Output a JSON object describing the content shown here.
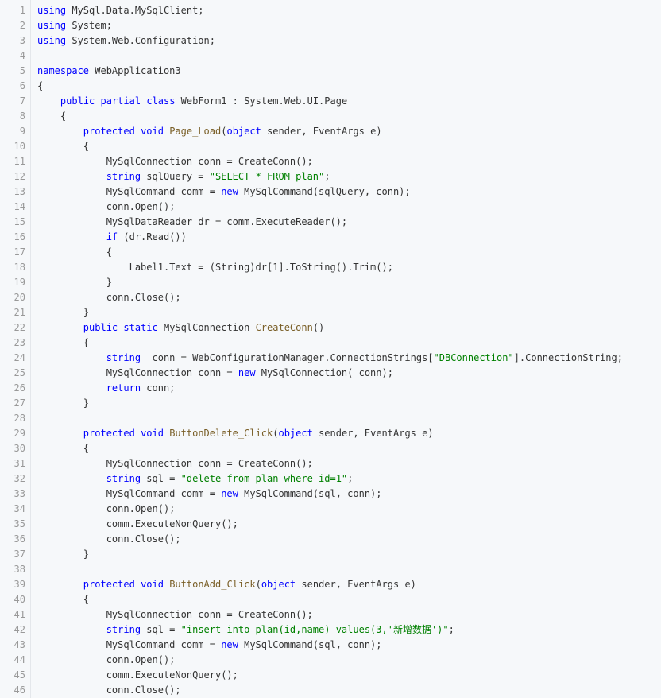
{
  "colors": {
    "background": "#f6f8fa",
    "line_number": "#999999",
    "text": "#333333",
    "keyword": "#0000ff",
    "string": "#008000",
    "method": "#795e26",
    "type": "#2b6ea8"
  },
  "code": {
    "lines": [
      {
        "n": "1",
        "tokens": [
          [
            "kw",
            "using"
          ],
          [
            "plain",
            " MySql.Data.MySqlClient;"
          ]
        ]
      },
      {
        "n": "2",
        "tokens": [
          [
            "kw",
            "using"
          ],
          [
            "plain",
            " System;"
          ]
        ]
      },
      {
        "n": "3",
        "tokens": [
          [
            "kw",
            "using"
          ],
          [
            "plain",
            " System.Web.Configuration;"
          ]
        ]
      },
      {
        "n": "4",
        "tokens": []
      },
      {
        "n": "5",
        "tokens": [
          [
            "kw",
            "namespace"
          ],
          [
            "plain",
            " WebApplication3"
          ]
        ]
      },
      {
        "n": "6",
        "tokens": [
          [
            "plain",
            "{"
          ]
        ]
      },
      {
        "n": "7",
        "tokens": [
          [
            "plain",
            "    "
          ],
          [
            "kw",
            "public"
          ],
          [
            "plain",
            " "
          ],
          [
            "kw",
            "partial"
          ],
          [
            "plain",
            " "
          ],
          [
            "kw",
            "class"
          ],
          [
            "plain",
            " WebForm1 : System.Web.UI.Page"
          ]
        ]
      },
      {
        "n": "8",
        "tokens": [
          [
            "plain",
            "    {"
          ]
        ]
      },
      {
        "n": "9",
        "tokens": [
          [
            "plain",
            "        "
          ],
          [
            "kw",
            "protected"
          ],
          [
            "plain",
            " "
          ],
          [
            "kw",
            "void"
          ],
          [
            "plain",
            " "
          ],
          [
            "fn",
            "Page_Load"
          ],
          [
            "plain",
            "("
          ],
          [
            "kw",
            "object"
          ],
          [
            "plain",
            " sender, EventArgs e)"
          ]
        ]
      },
      {
        "n": "10",
        "tokens": [
          [
            "plain",
            "        {"
          ]
        ]
      },
      {
        "n": "11",
        "tokens": [
          [
            "plain",
            "            MySqlConnection conn = CreateConn();"
          ]
        ]
      },
      {
        "n": "12",
        "tokens": [
          [
            "plain",
            "            "
          ],
          [
            "kw",
            "string"
          ],
          [
            "plain",
            " sqlQuery = "
          ],
          [
            "str",
            "\"SELECT * FROM plan\""
          ],
          [
            "plain",
            ";"
          ]
        ]
      },
      {
        "n": "13",
        "tokens": [
          [
            "plain",
            "            MySqlCommand comm = "
          ],
          [
            "kw",
            "new"
          ],
          [
            "plain",
            " MySqlCommand(sqlQuery, conn);"
          ]
        ]
      },
      {
        "n": "14",
        "tokens": [
          [
            "plain",
            "            conn.Open();"
          ]
        ]
      },
      {
        "n": "15",
        "tokens": [
          [
            "plain",
            "            MySqlDataReader dr = comm.ExecuteReader();"
          ]
        ]
      },
      {
        "n": "16",
        "tokens": [
          [
            "plain",
            "            "
          ],
          [
            "kw",
            "if"
          ],
          [
            "plain",
            " (dr.Read())"
          ]
        ]
      },
      {
        "n": "17",
        "tokens": [
          [
            "plain",
            "            {"
          ]
        ]
      },
      {
        "n": "18",
        "tokens": [
          [
            "plain",
            "                Label1.Text = (String)dr[1].ToString().Trim();"
          ]
        ]
      },
      {
        "n": "19",
        "tokens": [
          [
            "plain",
            "            }"
          ]
        ]
      },
      {
        "n": "20",
        "tokens": [
          [
            "plain",
            "            conn.Close();"
          ]
        ]
      },
      {
        "n": "21",
        "tokens": [
          [
            "plain",
            "        }"
          ]
        ]
      },
      {
        "n": "22",
        "tokens": [
          [
            "plain",
            "        "
          ],
          [
            "kw",
            "public"
          ],
          [
            "plain",
            " "
          ],
          [
            "kw",
            "static"
          ],
          [
            "plain",
            " MySqlConnection "
          ],
          [
            "fn",
            "CreateConn"
          ],
          [
            "plain",
            "()"
          ]
        ]
      },
      {
        "n": "23",
        "tokens": [
          [
            "plain",
            "        {"
          ]
        ]
      },
      {
        "n": "24",
        "tokens": [
          [
            "plain",
            "            "
          ],
          [
            "kw",
            "string"
          ],
          [
            "plain",
            " _conn = WebConfigurationManager.ConnectionStrings["
          ],
          [
            "str",
            "\"DBConnection\""
          ],
          [
            "plain",
            "].ConnectionString;"
          ]
        ]
      },
      {
        "n": "25",
        "tokens": [
          [
            "plain",
            "            MySqlConnection conn = "
          ],
          [
            "kw",
            "new"
          ],
          [
            "plain",
            " MySqlConnection(_conn);"
          ]
        ]
      },
      {
        "n": "26",
        "tokens": [
          [
            "plain",
            "            "
          ],
          [
            "kw",
            "return"
          ],
          [
            "plain",
            " conn;"
          ]
        ]
      },
      {
        "n": "27",
        "tokens": [
          [
            "plain",
            "        }"
          ]
        ]
      },
      {
        "n": "28",
        "tokens": []
      },
      {
        "n": "29",
        "tokens": [
          [
            "plain",
            "        "
          ],
          [
            "kw",
            "protected"
          ],
          [
            "plain",
            " "
          ],
          [
            "kw",
            "void"
          ],
          [
            "plain",
            " "
          ],
          [
            "fn",
            "ButtonDelete_Click"
          ],
          [
            "plain",
            "("
          ],
          [
            "kw",
            "object"
          ],
          [
            "plain",
            " sender, EventArgs e)"
          ]
        ]
      },
      {
        "n": "30",
        "tokens": [
          [
            "plain",
            "        {"
          ]
        ]
      },
      {
        "n": "31",
        "tokens": [
          [
            "plain",
            "            MySqlConnection conn = CreateConn();"
          ]
        ]
      },
      {
        "n": "32",
        "tokens": [
          [
            "plain",
            "            "
          ],
          [
            "kw",
            "string"
          ],
          [
            "plain",
            " sql = "
          ],
          [
            "str",
            "\"delete from plan where id=1\""
          ],
          [
            "plain",
            ";"
          ]
        ]
      },
      {
        "n": "33",
        "tokens": [
          [
            "plain",
            "            MySqlCommand comm = "
          ],
          [
            "kw",
            "new"
          ],
          [
            "plain",
            " MySqlCommand(sql, conn);"
          ]
        ]
      },
      {
        "n": "34",
        "tokens": [
          [
            "plain",
            "            conn.Open();"
          ]
        ]
      },
      {
        "n": "35",
        "tokens": [
          [
            "plain",
            "            comm.ExecuteNonQuery();"
          ]
        ]
      },
      {
        "n": "36",
        "tokens": [
          [
            "plain",
            "            conn.Close();"
          ]
        ]
      },
      {
        "n": "37",
        "tokens": [
          [
            "plain",
            "        }"
          ]
        ]
      },
      {
        "n": "38",
        "tokens": []
      },
      {
        "n": "39",
        "tokens": [
          [
            "plain",
            "        "
          ],
          [
            "kw",
            "protected"
          ],
          [
            "plain",
            " "
          ],
          [
            "kw",
            "void"
          ],
          [
            "plain",
            " "
          ],
          [
            "fn",
            "ButtonAdd_Click"
          ],
          [
            "plain",
            "("
          ],
          [
            "kw",
            "object"
          ],
          [
            "plain",
            " sender, EventArgs e)"
          ]
        ]
      },
      {
        "n": "40",
        "tokens": [
          [
            "plain",
            "        {"
          ]
        ]
      },
      {
        "n": "41",
        "tokens": [
          [
            "plain",
            "            MySqlConnection conn = CreateConn();"
          ]
        ]
      },
      {
        "n": "42",
        "tokens": [
          [
            "plain",
            "            "
          ],
          [
            "kw",
            "string"
          ],
          [
            "plain",
            " sql = "
          ],
          [
            "str",
            "\"insert into plan(id,name) values(3,'新增数据')\""
          ],
          [
            "plain",
            ";"
          ]
        ]
      },
      {
        "n": "43",
        "tokens": [
          [
            "plain",
            "            MySqlCommand comm = "
          ],
          [
            "kw",
            "new"
          ],
          [
            "plain",
            " MySqlCommand(sql, conn);"
          ]
        ]
      },
      {
        "n": "44",
        "tokens": [
          [
            "plain",
            "            conn.Open();"
          ]
        ]
      },
      {
        "n": "45",
        "tokens": [
          [
            "plain",
            "            comm.ExecuteNonQuery();"
          ]
        ]
      },
      {
        "n": "46",
        "tokens": [
          [
            "plain",
            "            conn.Close();"
          ]
        ]
      }
    ]
  }
}
